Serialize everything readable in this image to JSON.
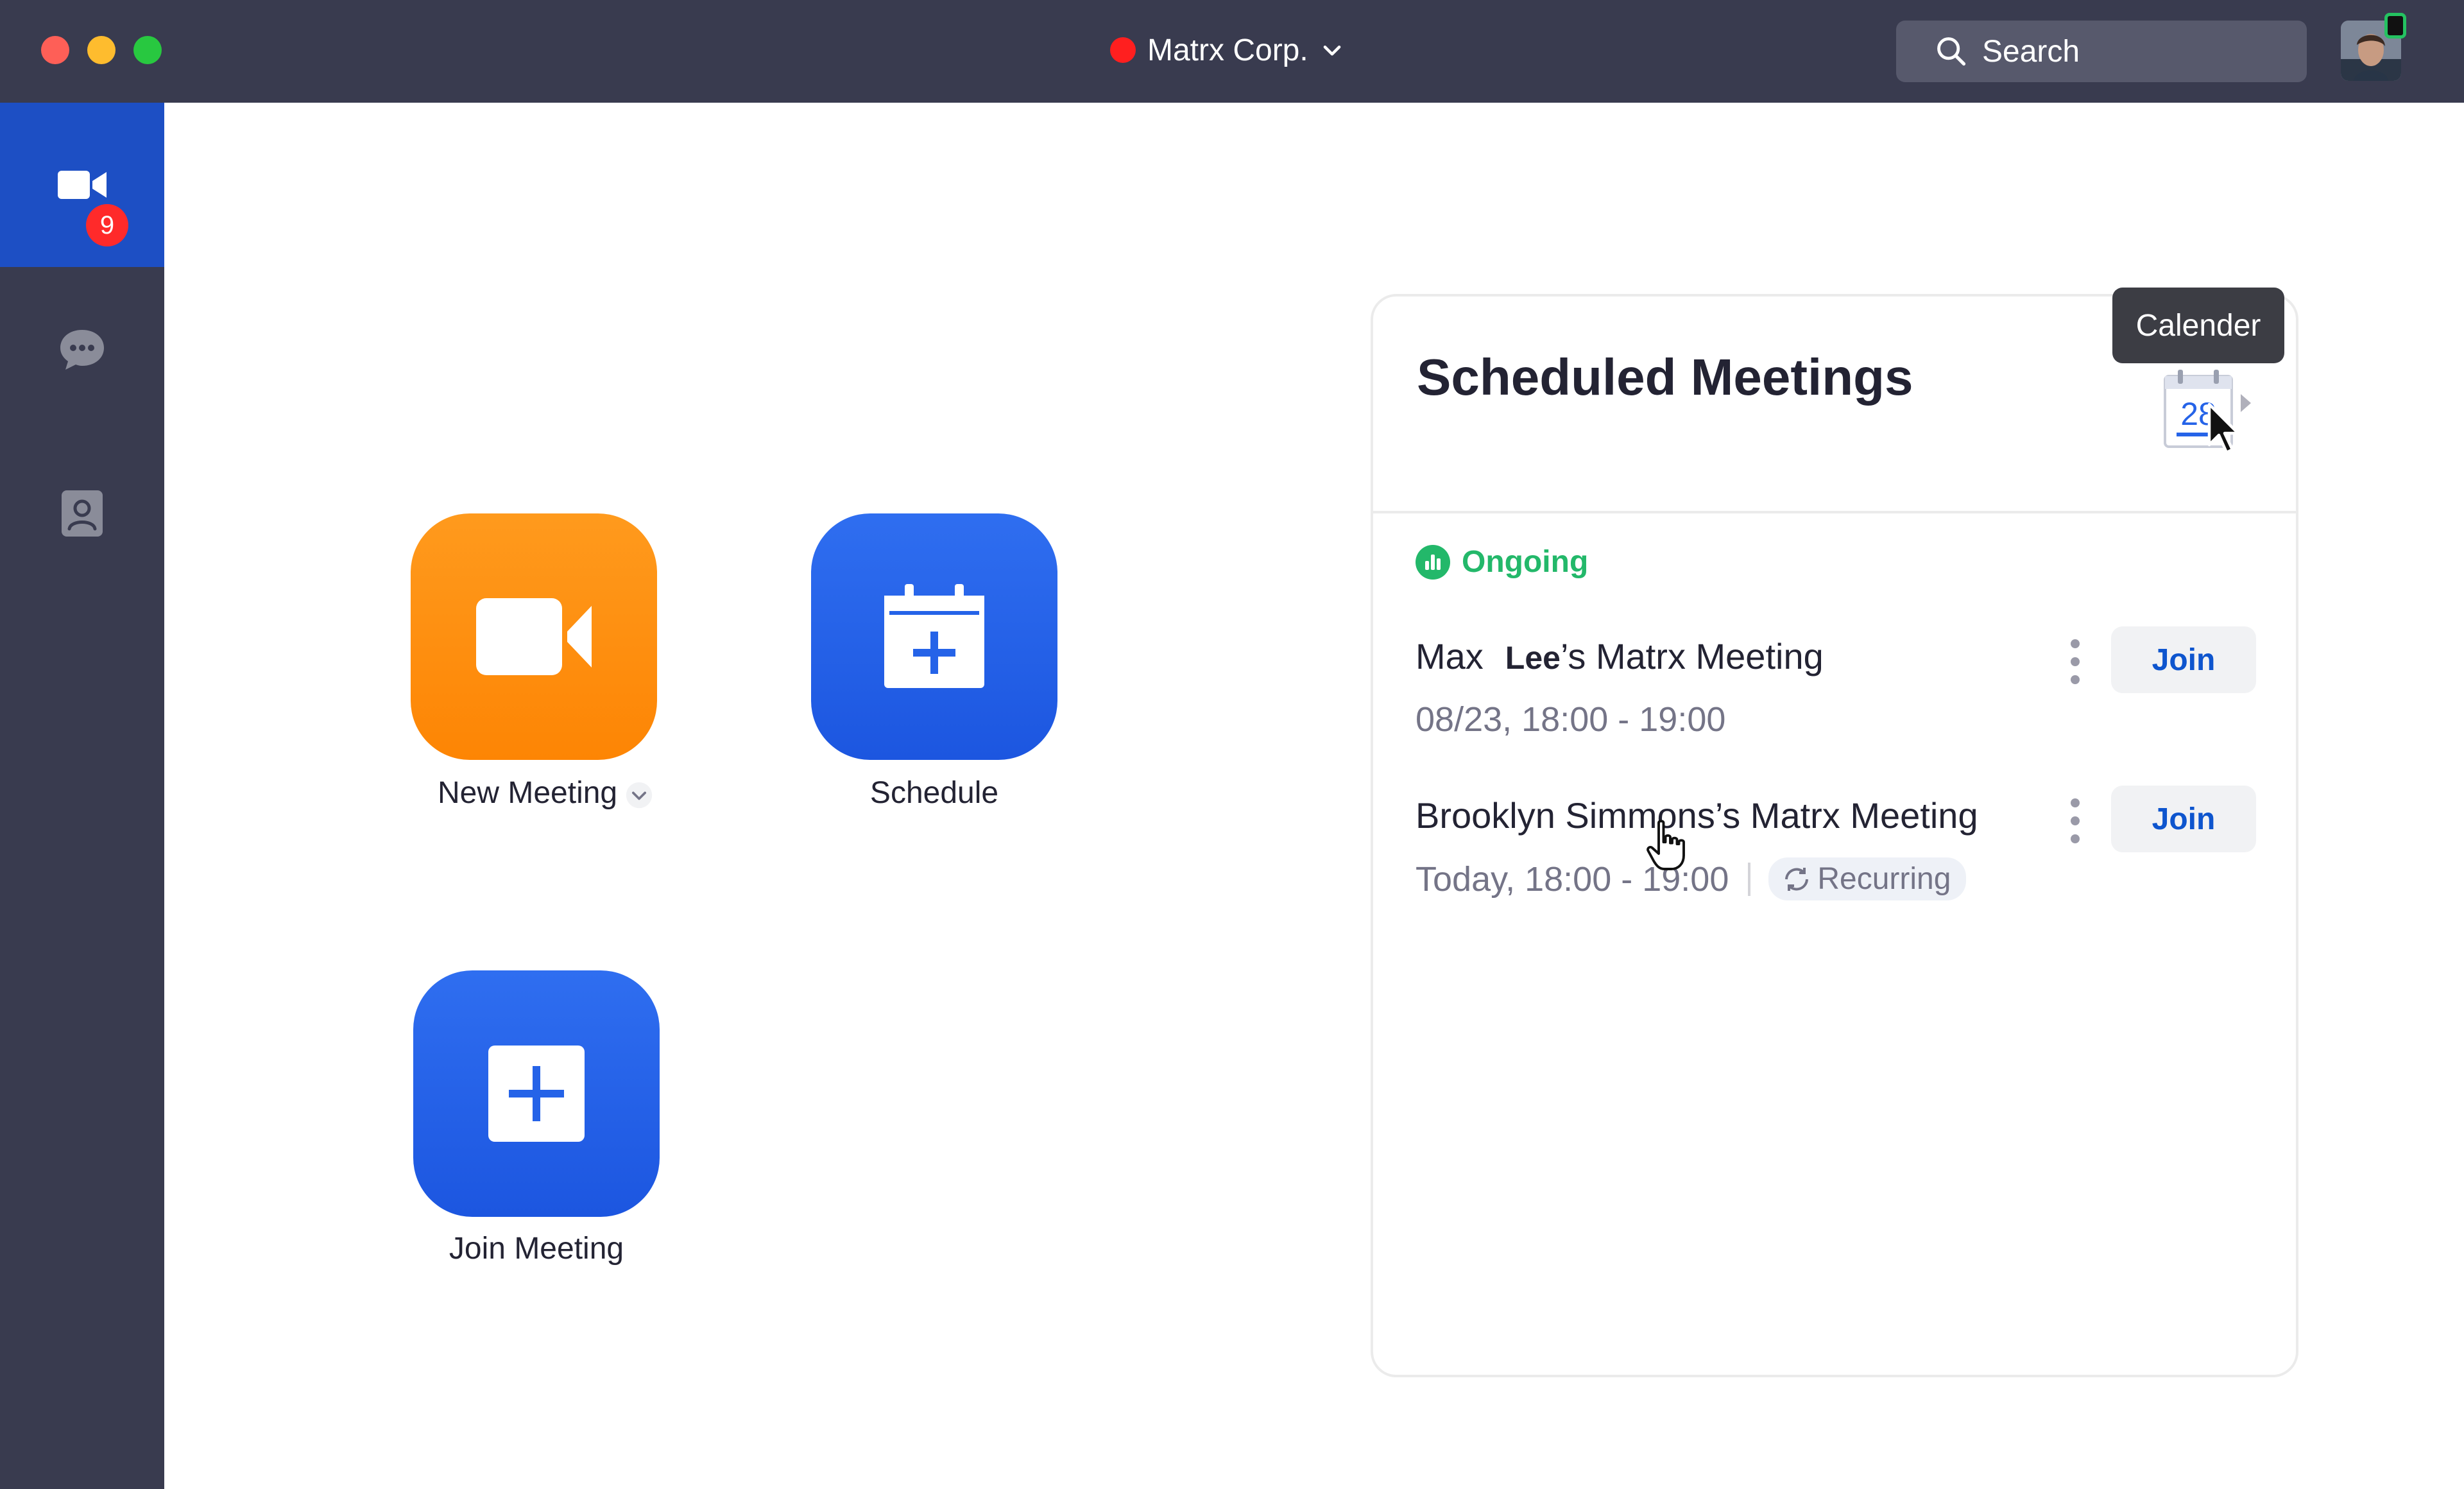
{
  "window": {
    "org_name": "Matrx Corp."
  },
  "search": {
    "label": "Search"
  },
  "sidebar": {
    "chat_badge": "9"
  },
  "actions": {
    "new_meeting": "New Meeting",
    "schedule": "Schedule",
    "join_meeting": "Join Meeting"
  },
  "meetings": {
    "title": "Scheduled Meetings",
    "calendar_day": "28",
    "tooltip": "Calender",
    "status": "Ongoing",
    "items": [
      {
        "host": "Max",
        "host_suffix": "Lee",
        "title_rest": "’s Matrx Meeting",
        "time": "08/23, 18:00 - 19:00",
        "join_label": "Join"
      },
      {
        "title": "Brooklyn Simmons’s Matrx Meeting",
        "time": "Today, 18:00 - 19:00",
        "tag": "Recurring",
        "join_label": "Join"
      }
    ]
  },
  "colors": {
    "titlebar": "#393b4f",
    "accent_blue": "#1d4fc4",
    "orange": "#fd8504",
    "ongoing_green": "#23b86a",
    "join_text": "#0e55ce"
  }
}
